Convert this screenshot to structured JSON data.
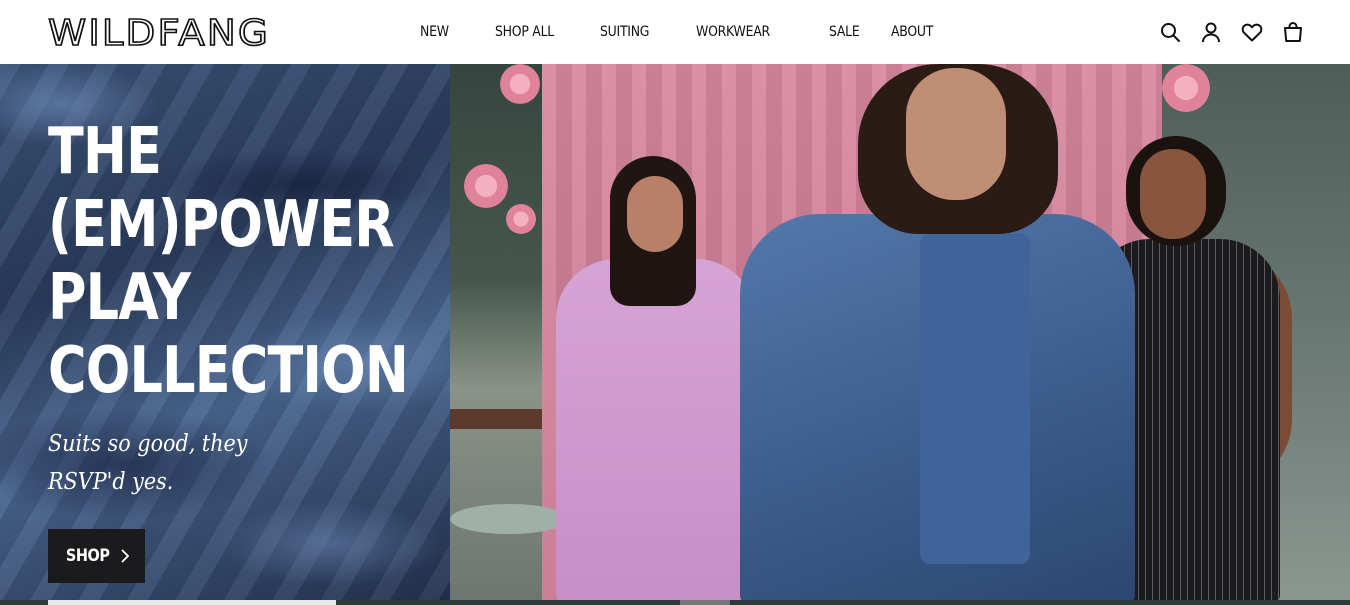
{
  "brand": {
    "logo_text": "WILDFANG"
  },
  "nav": {
    "items": [
      {
        "label": "NEW"
      },
      {
        "label": "SHOP ALL"
      },
      {
        "label": "SUITING"
      },
      {
        "label": "WORKWEAR"
      },
      {
        "label": "SALE"
      },
      {
        "label": "ABOUT"
      }
    ]
  },
  "header_icons": [
    "search-icon",
    "account-icon",
    "wishlist-heart-icon",
    "cart-bag-icon"
  ],
  "hero": {
    "headline_lines": [
      "THE",
      "(EM)POWER",
      "PLAY",
      "COLLECTION"
    ],
    "subline_lines": [
      "Suits so good, they",
      "RSVP'd yes."
    ],
    "cta_label": "SHOP",
    "cta_icon": "chevron-right-icon"
  },
  "colors": {
    "text": "#111111",
    "header_bg": "#ffffff",
    "cta_bg": "#1b1b1d",
    "hero_text": "#ffffff"
  }
}
